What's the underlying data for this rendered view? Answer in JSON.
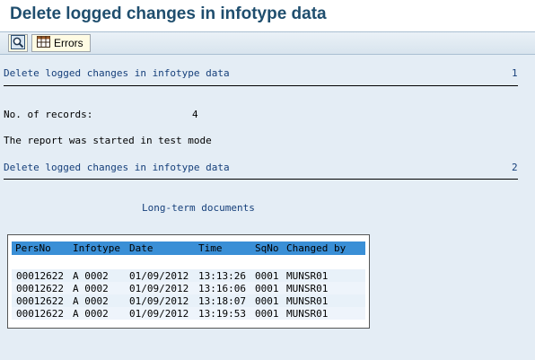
{
  "window": {
    "title": "Delete logged changes in infotype data"
  },
  "toolbar": {
    "detail_icon": "magnifier-icon",
    "errors_icon": "table-grid-icon",
    "errors_label": "Errors"
  },
  "report": {
    "header1": {
      "text": "Delete logged changes in infotype data",
      "page": "1"
    },
    "records_label": "No. of records:",
    "records_value": "4",
    "test_mode_text": "The report was started in test mode",
    "header2": {
      "text": "Delete logged changes in infotype data",
      "page": "2"
    },
    "section_title": "Long-term documents"
  },
  "table": {
    "columns": [
      "PersNo",
      "Infotype",
      "Date",
      "Time",
      "SqNo",
      "Changed by"
    ],
    "rows": [
      [
        "00012622",
        "A 0002",
        "01/09/2012",
        "13:13:26",
        "0001",
        "MUNSR01"
      ],
      [
        "00012622",
        "A 0002",
        "01/09/2012",
        "13:16:06",
        "0001",
        "MUNSR01"
      ],
      [
        "00012622",
        "A 0002",
        "01/09/2012",
        "13:18:07",
        "0001",
        "MUNSR01"
      ],
      [
        "00012622",
        "A 0002",
        "01/09/2012",
        "13:19:53",
        "0001",
        "MUNSR01"
      ]
    ]
  }
}
